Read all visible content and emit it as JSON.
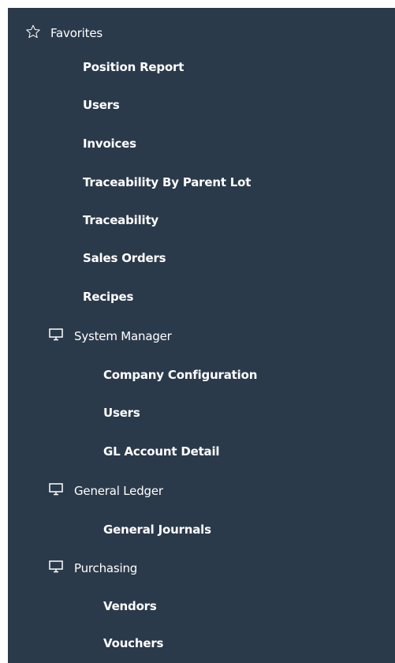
{
  "favorites": {
    "label": "Favorites",
    "items": [
      "Position Report",
      "Users",
      "Invoices",
      "Traceability By Parent Lot",
      "Traceability",
      "Sales Orders",
      "Recipes"
    ]
  },
  "groups": [
    {
      "label": "System Manager",
      "items": [
        "Company Configuration",
        "Users",
        "GL Account Detail"
      ]
    },
    {
      "label": "General Ledger",
      "items": [
        "General Journals"
      ]
    },
    {
      "label": "Purchasing",
      "items": [
        "Vendors",
        "Vouchers"
      ]
    }
  ],
  "icons": {
    "favorites": "star-outline-icon",
    "group": "monitor-icon"
  },
  "colors": {
    "panel_background": "#2b3a4a",
    "text": "#ffffff"
  }
}
